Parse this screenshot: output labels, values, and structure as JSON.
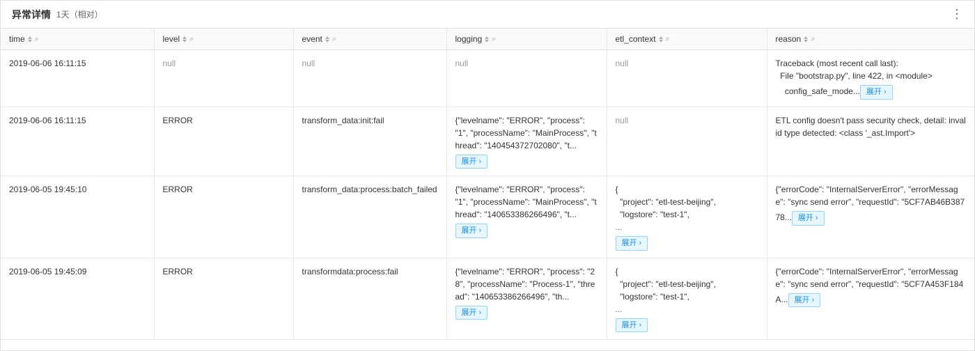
{
  "header": {
    "title": "异常详情",
    "subtitle": "1天（相对）",
    "more_icon": "⋮"
  },
  "columns": [
    {
      "key": "time",
      "label": "time",
      "sortable": true,
      "filterable": true
    },
    {
      "key": "level",
      "label": "level",
      "sortable": true,
      "filterable": true
    },
    {
      "key": "event",
      "label": "event",
      "sortable": true,
      "filterable": true
    },
    {
      "key": "logging",
      "label": "logging",
      "sortable": true,
      "filterable": true
    },
    {
      "key": "etl_context",
      "label": "etl_context",
      "sortable": true,
      "filterable": true
    },
    {
      "key": "reason",
      "label": "reason",
      "sortable": true,
      "filterable": true
    }
  ],
  "rows": [
    {
      "time": "2019-06-06 16:11:15",
      "level": "null",
      "level_null": true,
      "event": "null",
      "event_null": true,
      "logging": "null",
      "logging_null": true,
      "etl_context": "null",
      "etl_context_null": true,
      "reason": "Traceback (most recent call last):\n  File \"bootstrap.py\", line 422, in <module>\n    config_safe_mode...",
      "reason_has_expand": true,
      "logging_has_expand": false,
      "etl_has_expand": false
    },
    {
      "time": "2019-06-06 16:11:15",
      "level": "ERROR",
      "level_null": false,
      "event": "transform_data:init:fail",
      "event_null": false,
      "logging": "{\"levelname\": \"ERROR\", \"process\": \"1\", \"processName\": \"MainProcess\", \"thread\": \"140454372702080\", \"t...",
      "logging_null": false,
      "etl_context": "null",
      "etl_context_null": true,
      "reason": "ETL config doesn't pass security check, detail: invalid type detected: <class '_ast.Import'>",
      "reason_has_expand": false,
      "logging_has_expand": true,
      "etl_has_expand": false
    },
    {
      "time": "2019-06-05 19:45:10",
      "level": "ERROR",
      "level_null": false,
      "event": "transform_data:process:batch_failed",
      "event_null": false,
      "logging": "{\"levelname\": \"ERROR\", \"process\": \"1\", \"processName\": \"MainProcess\", \"thread\": \"140653386266496\", \"t...",
      "logging_null": false,
      "etl_context": "{\n  \"project\": \"etl-test-beijing\",\n  \"logstore\": \"test-1\",",
      "etl_context_null": false,
      "etl_context_ellipsis": true,
      "reason": "{\"errorCode\": \"InternalServerError\", \"errorMessage\": \"sync send error\", \"requestId\": \"5CF7AB46B38778...",
      "reason_has_expand": true,
      "logging_has_expand": true,
      "etl_has_expand": true
    },
    {
      "time": "2019-06-05 19:45:09",
      "level": "ERROR",
      "level_null": false,
      "event": "transformdata:process:fail",
      "event_null": false,
      "logging": "{\"levelname\": \"ERROR\", \"process\": \"28\", \"processName\": \"Process-1\", \"thread\": \"140653386266496\", \"th...",
      "logging_null": false,
      "etl_context": "{\n  \"project\": \"etl-test-beijing\",\n  \"logstore\": \"test-1\",",
      "etl_context_null": false,
      "etl_context_ellipsis": true,
      "reason": "{\"errorCode\": \"InternalServerError\", \"errorMessage\": \"sync send error\", \"requestId\": \"5CF7A453F184A...",
      "reason_has_expand": true,
      "logging_has_expand": true,
      "etl_has_expand": true
    }
  ],
  "expand_label": "展开",
  "expand_arrow": "›"
}
